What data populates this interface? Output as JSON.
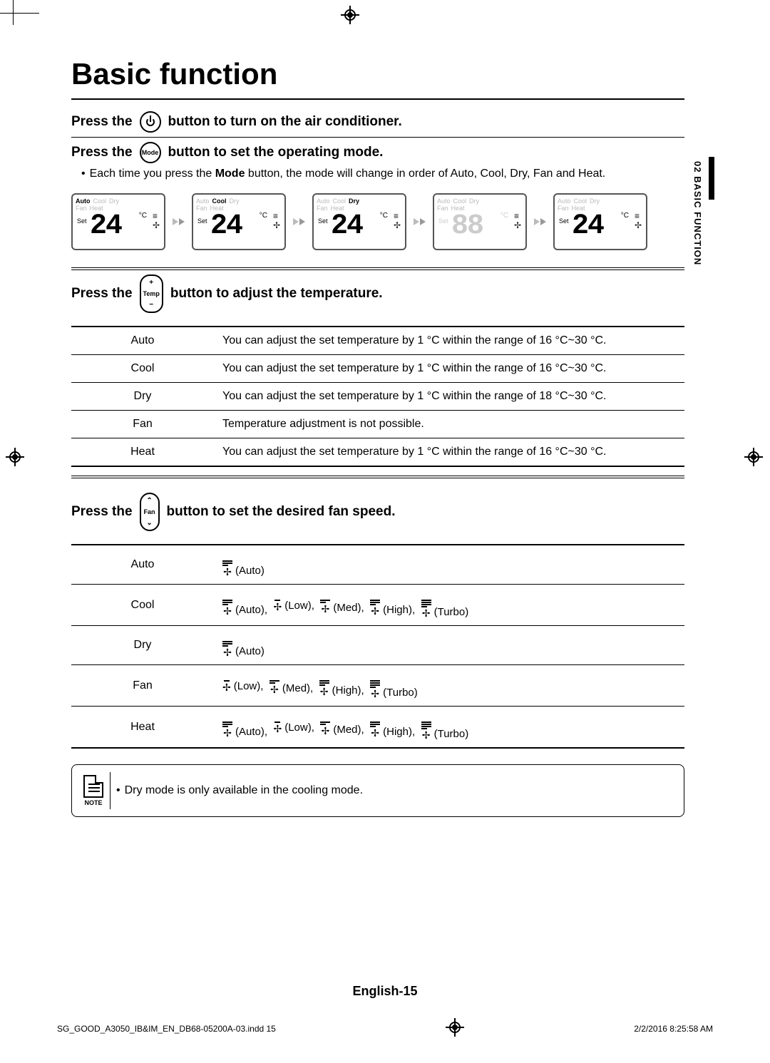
{
  "header": {
    "title": "Basic function"
  },
  "sideTab": {
    "label": "02  BASIC FUNCTION"
  },
  "step_power": {
    "prefix": "Press the",
    "suffix": "button to turn on the air conditioner.",
    "button_label": ""
  },
  "step_mode": {
    "prefix": "Press the",
    "button_label": "Mode",
    "suffix": "button to set the operating mode.",
    "desc_prefix": "Each time you press the ",
    "desc_bold": "Mode",
    "desc_suffix": " button, the mode will change in order of Auto, Cool, Dry, Fan and Heat."
  },
  "mode_lcds": [
    {
      "labels": [
        "Auto",
        "Cool",
        "Dry"
      ],
      "line2": [
        "Fan",
        "Heat"
      ],
      "active": "Auto",
      "temp": "24",
      "set": true,
      "show_temp": true
    },
    {
      "labels": [
        "Auto",
        "Cool",
        "Dry"
      ],
      "line2": [
        "Fan",
        "Heat"
      ],
      "active": "Cool",
      "temp": "24",
      "set": true,
      "show_temp": true
    },
    {
      "labels": [
        "Auto",
        "Cool",
        "Dry"
      ],
      "line2": [
        "Fan",
        "Heat"
      ],
      "active": "Dry",
      "temp": "24",
      "set": true,
      "show_temp": true
    },
    {
      "labels": [
        "Auto",
        "Cool",
        "Dry"
      ],
      "line2": [
        "Fan",
        "Heat"
      ],
      "active": "Fan",
      "temp": "88",
      "set": false,
      "show_temp": false
    },
    {
      "labels": [
        "Auto",
        "Cool",
        "Dry"
      ],
      "line2": [
        "Fan",
        "Heat"
      ],
      "active": "Heat",
      "temp": "24",
      "set": true,
      "show_temp": true
    }
  ],
  "step_temp": {
    "prefix": "Press the",
    "button_top": "+",
    "button_mid": "Temp",
    "button_bot": "−",
    "suffix": "button to adjust the temperature."
  },
  "temp_table": [
    {
      "mode": "Auto",
      "desc": "You can adjust the set temperature by 1 °C within the range of 16 °C~30 °C."
    },
    {
      "mode": "Cool",
      "desc": "You can adjust the set temperature by 1 °C within the range of 16 °C~30 °C."
    },
    {
      "mode": "Dry",
      "desc": "You can adjust the set temperature by 1 °C within the range of 18 °C~30 °C."
    },
    {
      "mode": "Fan",
      "desc": "Temperature adjustment is not possible."
    },
    {
      "mode": "Heat",
      "desc": "You can adjust the set temperature by 1 °C within the range of 16 °C~30 °C."
    }
  ],
  "step_fan": {
    "prefix": "Press the",
    "button_top": "⌃",
    "button_mid": "Fan",
    "button_bot": "⌄",
    "suffix": "button to set the desired fan speed."
  },
  "fan_table": [
    {
      "mode": "Auto",
      "speeds": [
        "(Auto)"
      ]
    },
    {
      "mode": "Cool",
      "speeds": [
        "(Auto),",
        "(Low),",
        "(Med),",
        "(High),",
        "(Turbo)"
      ]
    },
    {
      "mode": "Dry",
      "speeds": [
        "(Auto)"
      ]
    },
    {
      "mode": "Fan",
      "speeds": [
        "(Low),",
        "(Med),",
        "(High),",
        "(Turbo)"
      ]
    },
    {
      "mode": "Heat",
      "speeds": [
        "(Auto),",
        "(Low),",
        "(Med),",
        "(High),",
        "(Turbo)"
      ]
    }
  ],
  "note": {
    "label": "NOTE",
    "text": "Dry mode is only available in the cooling mode."
  },
  "footer": {
    "page_label": "English-15",
    "file": "SG_GOOD_A3050_IB&IM_EN_DB68-05200A-03.indd   15",
    "timestamp": "2/2/2016   8:25:58 AM"
  }
}
